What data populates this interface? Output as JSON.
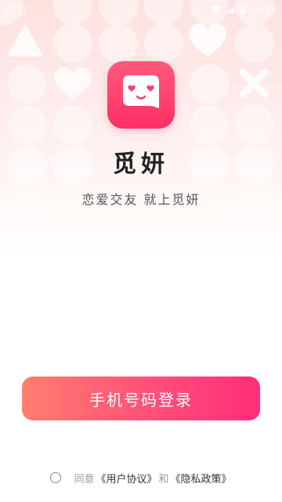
{
  "status_bar": {
    "time": "15:43"
  },
  "app": {
    "name": "觅妍",
    "slogan": "恋爱交友   就上觅妍"
  },
  "login": {
    "button_label": "手机号码登录"
  },
  "agreement": {
    "prefix": "同意",
    "user_agreement": "《用户协议》",
    "conjunction": "和",
    "privacy_policy": "《隐私政策》"
  },
  "colors": {
    "accent": "#ff3d6e",
    "button_gradient_start": "#ff7e6d",
    "button_gradient_end": "#ff2d79"
  }
}
